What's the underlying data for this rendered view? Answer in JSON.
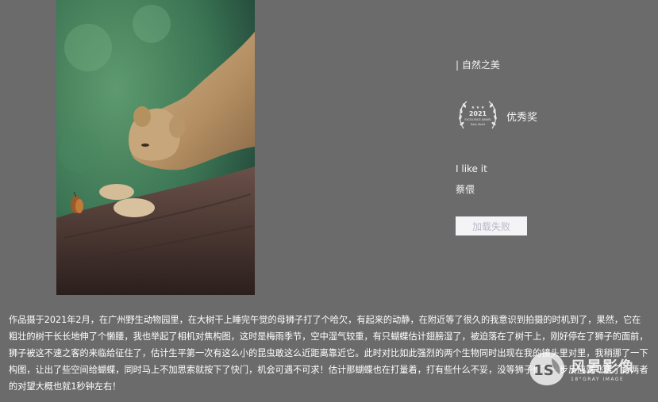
{
  "photo": {
    "alt": "lioness on tree branch with butterfly"
  },
  "category": "| 自然之美",
  "award": {
    "badge_year": "2021",
    "badge_line1": "EXCELLENCE AWARD",
    "badge_line2": "Daily World",
    "label": "优秀奖"
  },
  "work": {
    "title": "I like it",
    "author": "蔡偎"
  },
  "button": {
    "label": "加载失败"
  },
  "description": "作品摄于2021年2月，在广州野生动物园里，在大树干上睡完午觉的母狮子打了个哈欠，有起来的动静，在附近等了很久的我意识到拍摄的时机到了，果然，它在粗壮的树干长长地伸了个懒腰，我也举起了相机对焦构图，这时是梅雨季节，空中湿气较重，有只蝴蝶估计翅膀湿了，被迫落在了树干上，刚好停在了狮子的面前，狮子被这不速之客的来临给征住了，估计生平第一次有这么小的昆虫敢这么近距离靠近它。此时对比如此强烈的两个生物同时出现在我的镜头里对里，我稍挪了一下构图，让出了些空间给蝴蝶，同时马上不加思索就按下了快门，机会可遇不可求！估计那蝴蝶也在打量着，打有些什么不妥，没等狮子作下一步反应就飞走了，两者的对望大概也就1秒钟左右！",
  "watermark": {
    "logo_text": "1S",
    "cn": "风景影像",
    "en": "18°GRAY IMAGE"
  }
}
